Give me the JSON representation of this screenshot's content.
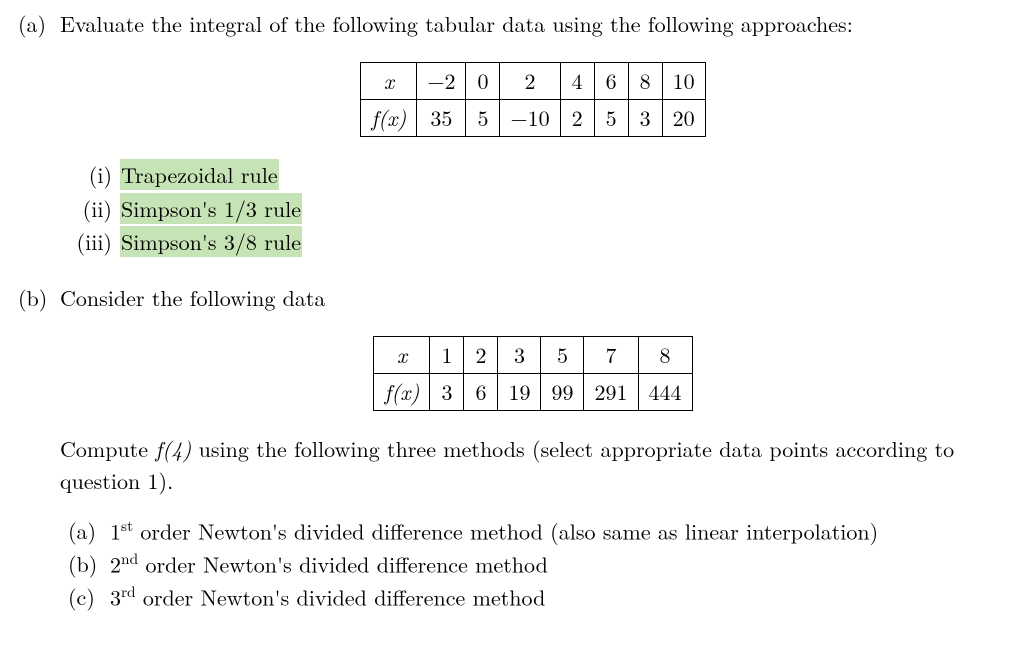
{
  "partA_marker": "(a)",
  "partA_intro": "Evaluate the integral of the following tabular data using the following approaches:",
  "tableA": {
    "row1_label": "x",
    "row1": [
      "−2",
      "0",
      "2",
      "4",
      "6",
      "8",
      "10"
    ],
    "row2_label": "f(x)",
    "row2": [
      "35",
      "5",
      "−10",
      "2",
      "5",
      "3",
      "20"
    ]
  },
  "subA": [
    {
      "marker": "(i)",
      "text": "Trapezoidal rule",
      "highlight": true
    },
    {
      "marker": "(ii)",
      "text": "Simpson's 1/3 rule",
      "highlight": true
    },
    {
      "marker": "(iii)",
      "text": "Simpson's 3/8 rule",
      "highlight": true
    }
  ],
  "partB_marker": "(b)",
  "partB_intro": "Consider the following data",
  "tableB": {
    "row1_label": "x",
    "row1": [
      "1",
      "2",
      "3",
      "5",
      "7",
      "8"
    ],
    "row2_label": "f(x)",
    "row2": [
      "3",
      "6",
      "19",
      "99",
      "291",
      "444"
    ]
  },
  "computeLine_pre": "Compute  ",
  "computeLine_mid": "f(4)",
  "computeLine_post": "  using the following three methods (select appropriate data points according to question 1).",
  "methods": [
    {
      "marker": "(a)",
      "pre": "1",
      "sup": "st",
      "rest": " order Newton's divided difference method (also same as linear interpolation)"
    },
    {
      "marker": "(b)",
      "pre": "2",
      "sup": "nd",
      "rest": " order Newton's divided difference method"
    },
    {
      "marker": "(c)",
      "pre": "3",
      "sup": "rd",
      "rest": " order Newton's divided difference method"
    }
  ]
}
